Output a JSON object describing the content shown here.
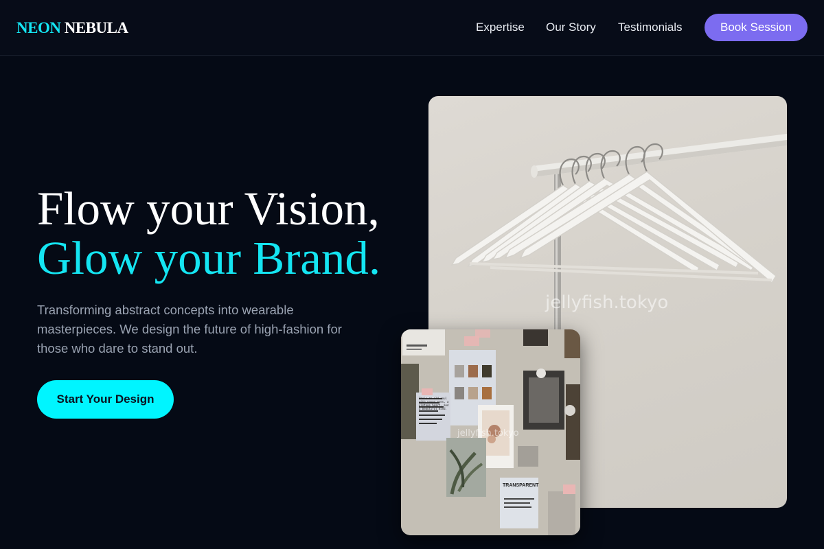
{
  "brand": {
    "logo_accent": "NEON",
    "logo_rest": "NEBULA",
    "accent_color": "#14e5f2",
    "button_color": "#7c6cf0"
  },
  "nav": {
    "links": [
      "Expertise",
      "Our Story",
      "Testimonials"
    ],
    "cta_label": "Book Session"
  },
  "hero": {
    "title_line1": "Flow your Vision,",
    "title_line2": "Glow your Brand.",
    "description": "Transforming abstract concepts into wearable masterpieces. We design the future of high-fashion for those who dare to stand out.",
    "cta_label": "Start Your Design"
  },
  "images": {
    "main_watermark": "jellyfish.tokyo",
    "small_watermark": "jellyfish.tokyo",
    "small_note_text": "She's an old soul with young eyes, a vintage heart, and a beautiful mind.",
    "small_tag_text": "TRANSPARENT"
  }
}
